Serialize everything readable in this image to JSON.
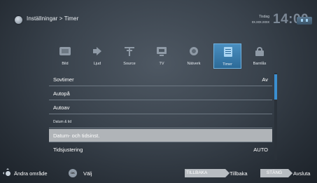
{
  "header": {
    "breadcrumb": "Inställningar > Timer",
    "day": "Tisdag",
    "date": "xx.xxx.xxxx",
    "time": "14:00"
  },
  "tabs": [
    {
      "label": "Bild",
      "icon": "picture-icon",
      "active": false
    },
    {
      "label": "Ljud",
      "icon": "speaker-icon",
      "active": false
    },
    {
      "label": "Source",
      "icon": "antenna-icon",
      "active": false
    },
    {
      "label": "TV",
      "icon": "tv-icon",
      "active": false
    },
    {
      "label": "Nätverk",
      "icon": "network-icon",
      "active": false
    },
    {
      "label": "Timer",
      "icon": "timer-icon",
      "active": true
    },
    {
      "label": "Barnlås",
      "icon": "child-lock-icon",
      "active": false
    }
  ],
  "menu": {
    "items": [
      {
        "label": "Sovtimer",
        "value": "Av"
      },
      {
        "label": "Autopå",
        "value": ""
      },
      {
        "label": "Autoav",
        "value": ""
      },
      {
        "label": "Datum & tid",
        "value": "",
        "section": true
      },
      {
        "label": "Datum- och tidsinst.",
        "value": "",
        "selected": true
      },
      {
        "label": "Tidsjustering",
        "value": "AUTO"
      }
    ]
  },
  "footer": {
    "change_area": "Ändra område",
    "ok_label": "OK",
    "select": "Välj",
    "back_button": "TILLBAKA",
    "back": "Tillbaka",
    "close_button": "STÄNG",
    "close": "Avsluta"
  },
  "colors": {
    "accent": "#3b8fd0",
    "selected_row": "#b0b4b8",
    "button": "#b7bcc1"
  }
}
